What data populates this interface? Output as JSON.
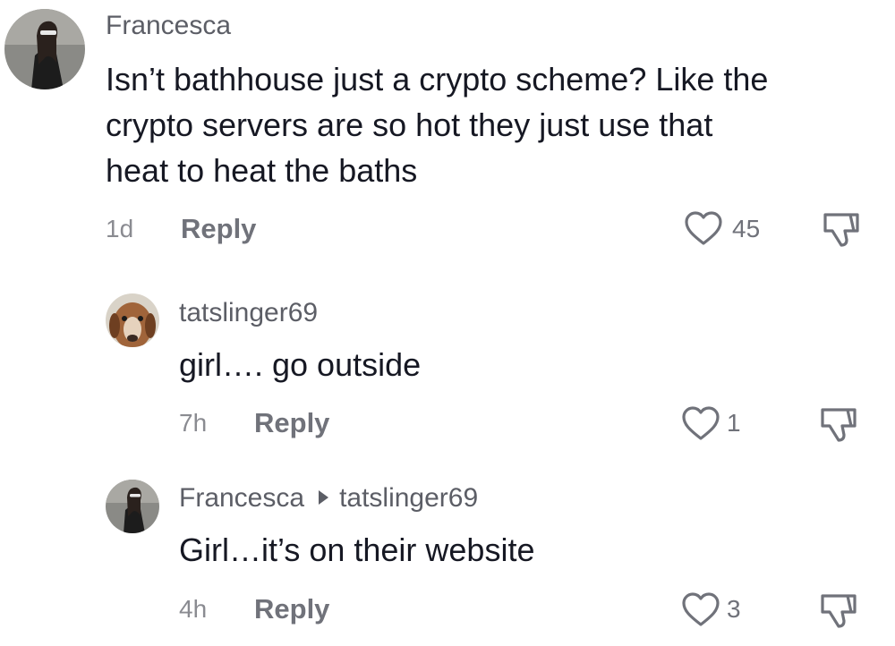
{
  "comments": [
    {
      "username": "Francesca",
      "text": "Isn’t bathhouse just a crypto scheme? Like the\ncrypto servers are so hot they just use that\nheat to heat the baths",
      "time": "1d",
      "reply_label": "Reply",
      "likes": "45"
    },
    {
      "username": "tatslinger69",
      "text": "girl…. go outside",
      "time": "7h",
      "reply_label": "Reply",
      "likes": "1"
    },
    {
      "username": "Francesca",
      "reply_to": "tatslinger69",
      "text": "Girl…it’s on their website",
      "time": "4h",
      "reply_label": "Reply",
      "likes": "3"
    }
  ],
  "icons": {
    "like": "heart-outline-icon",
    "dislike": "thumbs-down-outline-icon",
    "reply_to": "triangle-right-icon"
  },
  "colors": {
    "text": "#161823",
    "username": "#5c5e66",
    "meta": "#8a8b91",
    "action": "#70727a"
  }
}
